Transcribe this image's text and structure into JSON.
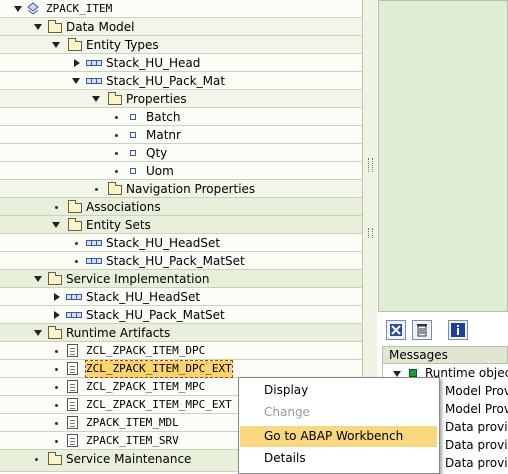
{
  "tree": {
    "root_label": "ZPACK_ITEM",
    "data_model": "Data Model",
    "entity_types": "Entity Types",
    "entity_head": "Stack_HU_Head",
    "entity_pack": "Stack_HU_Pack_Mat",
    "properties": "Properties",
    "prop_batch": "Batch",
    "prop_matnr": "Matnr",
    "prop_qty": "Qty",
    "prop_uom": "Uom",
    "nav_properties": "Navigation Properties",
    "associations": "Associations",
    "entity_sets": "Entity Sets",
    "set_head": "Stack_HU_HeadSet",
    "set_pack": "Stack_HU_Pack_MatSet",
    "service_impl": "Service Implementation",
    "impl_head": "Stack_HU_HeadSet",
    "impl_pack": "Stack_HU_Pack_MatSet",
    "runtime_artifacts": "Runtime Artifacts",
    "art_dpc": "ZCL_ZPACK_ITEM_DPC",
    "art_dpc_ext": "ZCL_ZPACK_ITEM_DPC_EXT",
    "art_mpc": "ZCL_ZPACK_ITEM_MPC",
    "art_mpc_ext": "ZCL_ZPACK_ITEM_MPC_EXT",
    "art_mdl": "ZPACK_ITEM_MDL",
    "art_srv": "ZPACK_ITEM_SRV",
    "service_maintenance": "Service Maintenance"
  },
  "messages": {
    "header": "Messages",
    "runtime": "Runtime objects",
    "lines": [
      "Model Provi",
      "Model Provi",
      "Data provid",
      "Data provid",
      "Data provid"
    ]
  },
  "context_menu": {
    "display": "Display",
    "change": "Change",
    "goto": "Go to ABAP Workbench",
    "details": "Details"
  },
  "colors": {
    "tree_bg": "#f2f6ea",
    "highlight": "#f9d77f",
    "status_green": "#17a02c"
  }
}
